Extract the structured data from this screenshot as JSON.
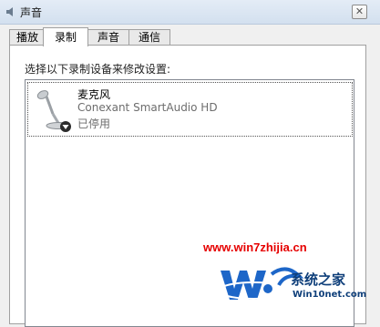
{
  "window": {
    "title": "声音",
    "close_glyph": "✕"
  },
  "tabs": [
    {
      "label": "播放",
      "active": false
    },
    {
      "label": "录制",
      "active": true
    },
    {
      "label": "声音",
      "active": false
    },
    {
      "label": "通信",
      "active": false
    }
  ],
  "panel": {
    "instruction": "选择以下录制设备来修改设置:"
  },
  "devices": [
    {
      "name": "麦克风",
      "driver": "Conexant SmartAudio HD",
      "status": "已停用",
      "icon": "microphone-icon",
      "badge": "down-arrow-badge"
    }
  ],
  "watermark": {
    "url": "www.win7zhijia.cn",
    "site_name": "系统之家",
    "domain": "Win10net.com"
  },
  "colors": {
    "titlebar": "#dbe6f3",
    "panel_bg": "#ffffff",
    "watermark_red": "#e60000",
    "watermark_blue": "#0f3f7a"
  }
}
